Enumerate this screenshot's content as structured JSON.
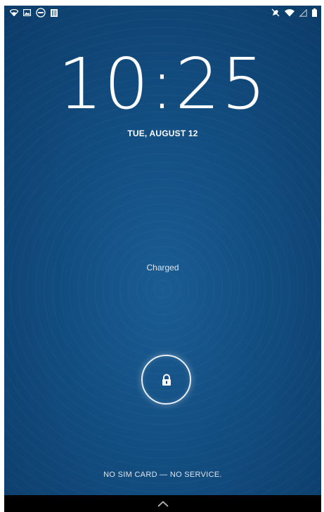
{
  "status_bar": {
    "left_icons": [
      "wifi-icon",
      "image-icon",
      "dell-icon",
      "storage-icon"
    ],
    "right_icons": [
      "mute-icon",
      "wifi-icon",
      "signal-icon",
      "battery-icon"
    ]
  },
  "lockscreen": {
    "time": "10:25",
    "date": "TUE, AUGUST 12",
    "charge_status": "Charged",
    "carrier_status": "NO SIM CARD — NO SERVICE."
  },
  "lock": {
    "icon": "lock-icon"
  },
  "nav": {
    "icon": "chevron-up-icon"
  },
  "colors": {
    "background": "#124d80",
    "text": "#ffffff"
  }
}
